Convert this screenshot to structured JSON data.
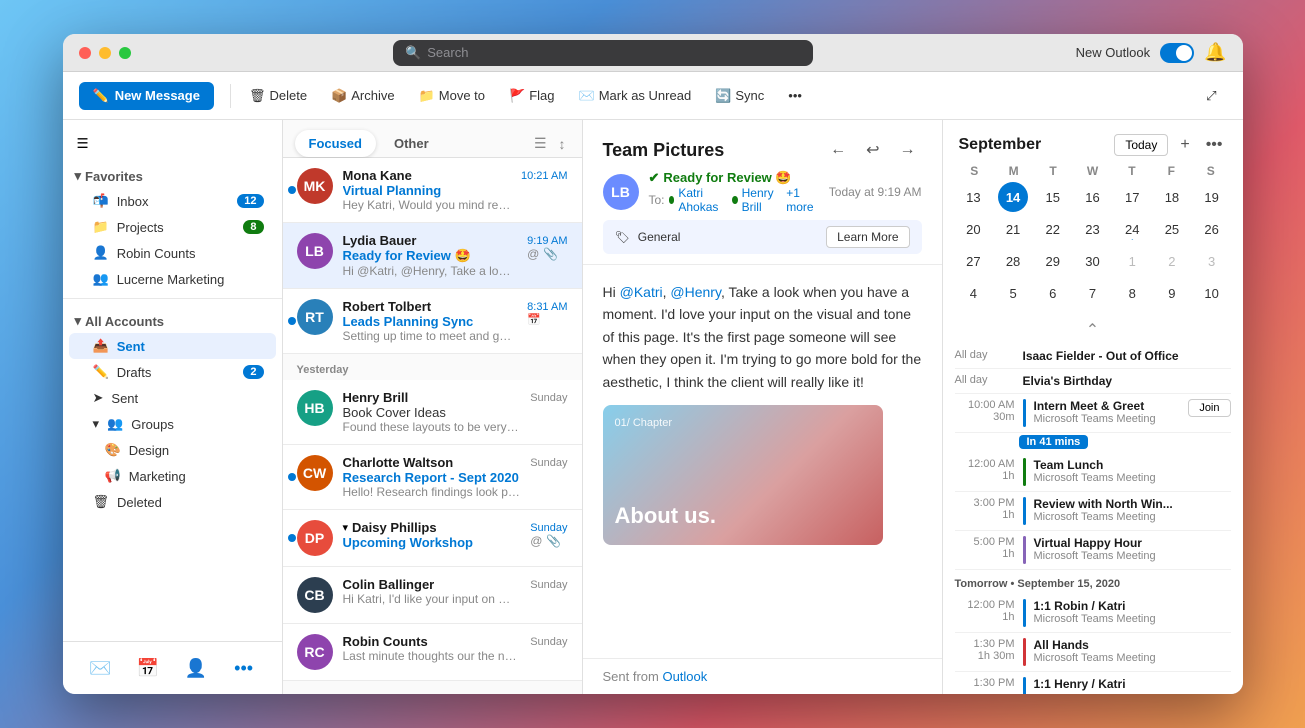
{
  "window": {
    "title": "Outlook",
    "new_outlook_label": "New Outlook"
  },
  "search": {
    "placeholder": "Search"
  },
  "toolbar": {
    "new_message": "New Message",
    "delete": "Delete",
    "archive": "Archive",
    "move_to": "Move to",
    "flag": "Flag",
    "mark_as_unread": "Mark as Unread",
    "sync": "Sync"
  },
  "sidebar": {
    "favorites_label": "Favorites",
    "inbox_label": "Inbox",
    "inbox_count": "12",
    "projects_label": "Projects",
    "projects_count": "8",
    "robin_counts_label": "Robin Counts",
    "lucerne_label": "Lucerne Marketing",
    "all_accounts_label": "All Accounts",
    "sent_label": "Sent",
    "drafts_label": "Drafts",
    "drafts_count": "2",
    "sent2_label": "Sent",
    "groups_label": "Groups",
    "design_label": "Design",
    "marketing_label": "Marketing",
    "deleted_label": "Deleted"
  },
  "message_list": {
    "tab_focused": "Focused",
    "tab_other": "Other",
    "messages": [
      {
        "sender": "Mona Kane",
        "subject": "Virtual Planning",
        "preview": "Hey Katri, Would you mind reading the draft...",
        "time": "10:21 AM",
        "unread": true,
        "selected": false,
        "avatar_bg": "#c0392b",
        "avatar_initials": "MK"
      },
      {
        "sender": "Lydia Bauer",
        "subject": "Ready for Review 🤩",
        "preview": "Hi @Katri, @Henry, Take a look when you have...",
        "time": "9:19 AM",
        "unread": false,
        "selected": true,
        "avatar_bg": "#8e44ad",
        "avatar_initials": "LB",
        "has_at": true,
        "has_attach": true
      },
      {
        "sender": "Robert Tolbert",
        "subject": "Leads Planning Sync",
        "preview": "Setting up time to meet and go over planning...",
        "time": "8:31 AM",
        "unread": true,
        "selected": false,
        "avatar_bg": "#2980b9",
        "avatar_initials": "RT",
        "has_calendar": true
      }
    ],
    "yesterday_label": "Yesterday",
    "yesterday_messages": [
      {
        "sender": "Henry Brill",
        "subject": "Book Cover Ideas",
        "preview": "Found these layouts to be very compelling...",
        "time": "Sunday",
        "unread": false,
        "avatar_bg": "#16a085",
        "avatar_initials": "HB"
      },
      {
        "sender": "Charlotte Waltson",
        "subject": "Research Report - Sept 2020",
        "preview": "Hello! Research findings look positive for...",
        "time": "Sunday",
        "unread": true,
        "avatar_bg": "#d35400",
        "avatar_initials": "CW"
      },
      {
        "sender": "Daisy Phillips",
        "subject": "Upcoming Workshop",
        "preview": "",
        "time": "Sunday",
        "unread": true,
        "avatar_bg": "#e74c3c",
        "avatar_initials": "DP",
        "has_at": true,
        "has_attach": true,
        "collapsed": true
      },
      {
        "sender": "Colin Ballinger",
        "subject": "",
        "preview": "Hi Katri, I'd like your input on material...",
        "time": "Sunday",
        "unread": false,
        "avatar_bg": "#2c3e50",
        "avatar_initials": "CB"
      },
      {
        "sender": "Robin Counts",
        "subject": "",
        "preview": "Last minute thoughts our the next...",
        "time": "Sunday",
        "unread": false,
        "avatar_bg": "#8e44ad",
        "avatar_initials": "RC"
      }
    ]
  },
  "email": {
    "subject": "Team Pictures",
    "status": "Ready for Review 🤩",
    "time": "Today at 9:19 AM",
    "to_label": "To:",
    "recipient1": "Katri Ahokas",
    "recipient2": "Henry Brill",
    "more": "+1 more",
    "tag_label": "General",
    "learn_more": "Learn More",
    "body_line1": "Hi ",
    "mention1": "@Katri",
    "body_line2": ", ",
    "mention2": "@Henry",
    "body_line3": ", Take a look when you have a moment. I'd love your input on the visual and tone of this page. It's the first page someone will see when they open it. I'm trying to go more bold for the aesthetic, I think the client will really like it!",
    "image_chapter": "01/ Chapter",
    "image_title": "About us.",
    "footer_text": "Sent from ",
    "footer_link": "Outlook"
  },
  "calendar": {
    "month": "September",
    "today_btn": "Today",
    "weekdays": [
      "S",
      "M",
      "T",
      "W",
      "T",
      "F",
      "S"
    ],
    "days": [
      {
        "day": 13,
        "other": false
      },
      {
        "day": 14,
        "today": true
      },
      {
        "day": 15,
        "other": false
      },
      {
        "day": 16,
        "other": false
      },
      {
        "day": 17,
        "other": false
      },
      {
        "day": 18,
        "other": false
      },
      {
        "day": 19,
        "other": false
      },
      {
        "day": 20
      },
      {
        "day": 21
      },
      {
        "day": 22
      },
      {
        "day": 23
      },
      {
        "day": 24
      },
      {
        "day": 25
      },
      {
        "day": 26
      },
      {
        "day": 27
      },
      {
        "day": 28
      },
      {
        "day": 29
      },
      {
        "day": 30
      },
      {
        "day": 1,
        "other": true
      },
      {
        "day": 2,
        "other": true
      },
      {
        "day": 3,
        "other": true
      },
      {
        "day": 4
      },
      {
        "day": 5
      },
      {
        "day": 6
      },
      {
        "day": 7
      },
      {
        "day": 8
      },
      {
        "day": 9
      },
      {
        "day": 10
      }
    ],
    "allday_events": [
      {
        "label": "All day",
        "title": "Isaac Fielder - Out of Office"
      },
      {
        "label": "All day",
        "title": "Elvia's Birthday"
      }
    ],
    "events": [
      {
        "time": "10:00 AM",
        "duration": "30m",
        "title": "Intern Meet & Greet",
        "sub": "Microsoft Teams Meeting",
        "color": "#0078d4",
        "in_mins": "In 41 mins",
        "join": true
      },
      {
        "time": "12:00 AM",
        "duration": "1h",
        "title": "Team Lunch",
        "sub": "Microsoft Teams Meeting",
        "color": "#107c10"
      },
      {
        "time": "3:00 PM",
        "duration": "1h",
        "title": "Review with North Win...",
        "sub": "Microsoft Teams Meeting",
        "color": "#0078d4"
      },
      {
        "time": "5:00 PM",
        "duration": "1h",
        "title": "Virtual Happy Hour",
        "sub": "Microsoft Teams Meeting",
        "color": "#8764b8"
      }
    ],
    "tomorrow_label": "Tomorrow • September 15, 2020",
    "tomorrow_events": [
      {
        "time": "12:00 PM",
        "duration": "1h",
        "title": "1:1 Robin / Katri",
        "sub": "Microsoft Teams Meeting",
        "color": "#0078d4"
      },
      {
        "time": "1:30 PM",
        "duration": "1h 30m",
        "title": "All Hands",
        "sub": "Microsoft Teams Meeting",
        "color": "#d13438"
      },
      {
        "time": "1:30 PM",
        "duration": "",
        "title": "1:1 Henry / Katri",
        "sub": "",
        "color": "#0078d4"
      }
    ]
  }
}
